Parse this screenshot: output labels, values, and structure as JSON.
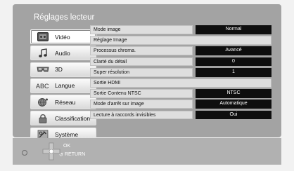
{
  "title": "Réglages lecteur",
  "nav": [
    {
      "label": "Vidéo",
      "icon": "video-tape-icon",
      "active": true
    },
    {
      "label": "Audio",
      "icon": "music-note-icon",
      "active": false
    },
    {
      "label": "3D",
      "icon": "3d-glasses-icon",
      "active": false
    },
    {
      "label": "Langue",
      "icon": "abc-language-icon",
      "active": false
    },
    {
      "label": "Réseau",
      "icon": "network-globe-icon",
      "active": false
    },
    {
      "label": "Classification",
      "icon": "padlock-icon",
      "active": false
    },
    {
      "label": "Système",
      "icon": "system-tools-icon",
      "active": false
    }
  ],
  "settings": [
    {
      "label": "Mode image",
      "value": "Normal"
    },
    {
      "label": "Réglage Image",
      "value": null
    },
    {
      "label": "Processus chroma.",
      "value": "Avancé"
    },
    {
      "label": "Clarté du détail",
      "value": "0"
    },
    {
      "label": "Super résolution",
      "value": "1"
    },
    {
      "label": "Sortie HDMI",
      "value": null
    },
    {
      "label": "Sortie Contenu NTSC",
      "value": "NTSC"
    },
    {
      "label": "Mode d'arrêt sur image",
      "value": "Automatique"
    },
    {
      "label": "Lecture à raccords invisibles",
      "value": "Oui"
    }
  ],
  "footer": {
    "ok_label": "OK",
    "return_label": "RETURN",
    "icons": [
      "dpad-icon",
      "return-circle-icon"
    ]
  },
  "colors": {
    "panel": "#a3a3a3",
    "footer": "#b1b1b1",
    "value_bg": "#0e0e0e",
    "row_bg": "#dedede"
  }
}
